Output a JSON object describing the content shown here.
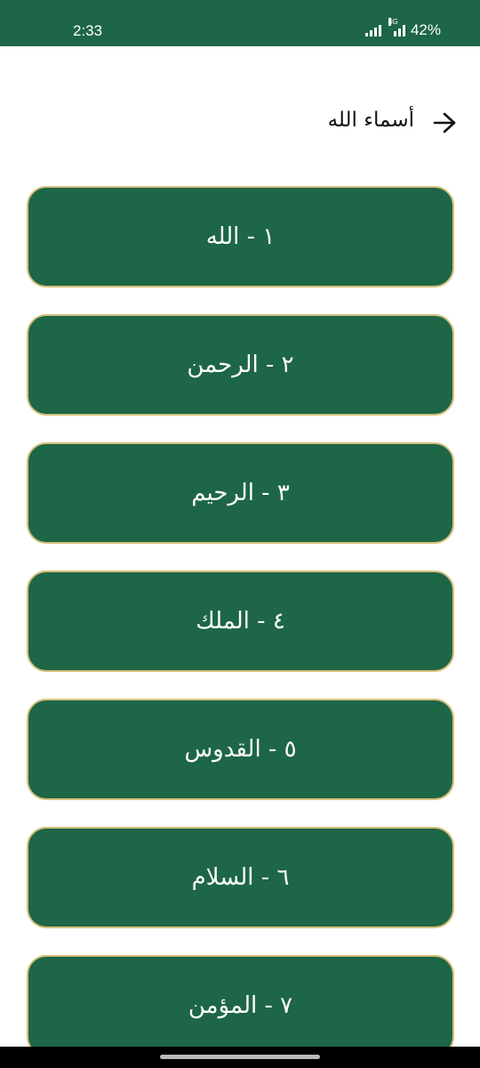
{
  "status_bar": {
    "time": "2:33",
    "network": "4G",
    "battery": "42%"
  },
  "header": {
    "title": "أسماء الله",
    "back_icon": "arrow-right-icon"
  },
  "names": [
    {
      "label": "١ - الله"
    },
    {
      "label": "٢ - الرحمن"
    },
    {
      "label": "٣ - الرحيم"
    },
    {
      "label": "٤ - الملك"
    },
    {
      "label": "٥ - القدوس"
    },
    {
      "label": "٦ - السلام"
    },
    {
      "label": "٧ - المؤمن"
    }
  ],
  "colors": {
    "primary": "#1d6647",
    "card_border": "#d6c07a",
    "text_on_primary": "#ffffff"
  }
}
